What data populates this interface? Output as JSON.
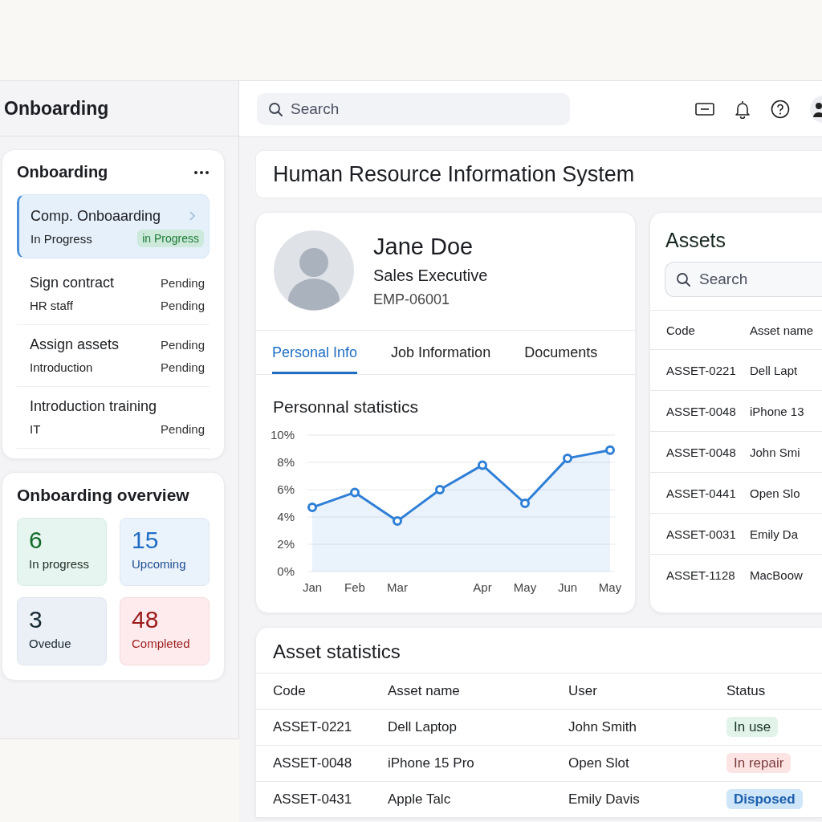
{
  "sidebar": {
    "title": "Onboarding",
    "onboarding_card": {
      "title": "Onboarding",
      "tasks": [
        {
          "title": "Comp. Onboaarding",
          "subtitle": "In Progress",
          "status": "in Progress",
          "selected": true
        },
        {
          "title": "Sign contract",
          "title_status": "Pending",
          "subtitle": "HR staff",
          "status": "Pending",
          "selected": false
        },
        {
          "title": "Assign assets",
          "title_status": "Pending",
          "subtitle": "Introduction",
          "status": "Pending",
          "selected": false
        },
        {
          "title": "Introduction training",
          "subtitle": "IT",
          "status": "Pending",
          "selected": false
        }
      ]
    },
    "overview": {
      "title": "Onboarding overview",
      "tiles": [
        {
          "value": "6",
          "label": "In progress",
          "kind": "progress"
        },
        {
          "value": "15",
          "label": "Upcoming",
          "kind": "upcoming"
        },
        {
          "value": "3",
          "label": "Ovedue",
          "kind": "overdue"
        },
        {
          "value": "48",
          "label": "Completed",
          "kind": "completed"
        }
      ]
    }
  },
  "topbar": {
    "search": {
      "placeholder": "Search"
    }
  },
  "page_title": "Human Resource Information System",
  "profile": {
    "name": "Jane Doe",
    "role": "Sales Executive",
    "employee_id": "EMP-06001",
    "tabs": [
      {
        "label": "Personal Info",
        "selected": true
      },
      {
        "label": "Job Information",
        "selected": false
      },
      {
        "label": "Documents",
        "selected": false
      }
    ],
    "stats": {
      "title": "Personnal statistics",
      "chart_data": {
        "type": "area",
        "categories": [
          "Jan",
          "Feb",
          "Mar",
          null,
          "Apr",
          "May",
          "Jun",
          "May"
        ],
        "ylim": [
          0,
          10
        ],
        "grid": true,
        "yticks": [
          {
            "value": 0,
            "label": "0%"
          },
          {
            "value": 2,
            "label": "2%"
          },
          {
            "value": 4,
            "label": "4%"
          },
          {
            "value": 6,
            "label": "6%"
          },
          {
            "value": 8,
            "label": "8%"
          },
          {
            "value": 10,
            "label": "10%"
          }
        ],
        "series": [
          {
            "color": "#2f7fd6",
            "values": [
              4.7,
              5.8,
              3.7,
              6.0,
              7.8,
              5.0,
              8.3,
              8.9
            ]
          }
        ]
      }
    }
  },
  "assets": {
    "title": "Assets",
    "search": {
      "placeholder": "Search"
    },
    "columns": [
      "Code",
      "Asset name"
    ],
    "rows": [
      [
        "ASSET-0221",
        "Dell Lapt"
      ],
      [
        "ASSET-0048",
        "iPhone 13"
      ],
      [
        "ASSET-0048",
        "John Smi"
      ],
      [
        "ASSET-0441",
        "Open Slo"
      ],
      [
        "ASSET-0031",
        "Emily Da"
      ],
      [
        "ASSET-1128",
        "MacBoow"
      ]
    ]
  },
  "asset_statistics": {
    "title": "Asset statistics",
    "columns": [
      "Code",
      "Asset name",
      "User",
      "Status"
    ],
    "rows": [
      {
        "code": "ASSET-0221",
        "asset_name": "Dell Laptop",
        "user": "John Smith",
        "status": "In use",
        "kind": "use"
      },
      {
        "code": "ASSET-0048",
        "asset_name": "iPhone 15 Pro",
        "user": "Open Slot",
        "status": "In repair",
        "kind": "repair"
      },
      {
        "code": "ASSET-0431",
        "asset_name": "Apple Talc",
        "user": "Emily Davis",
        "status": "Disposed",
        "kind": "disposed"
      }
    ]
  }
}
